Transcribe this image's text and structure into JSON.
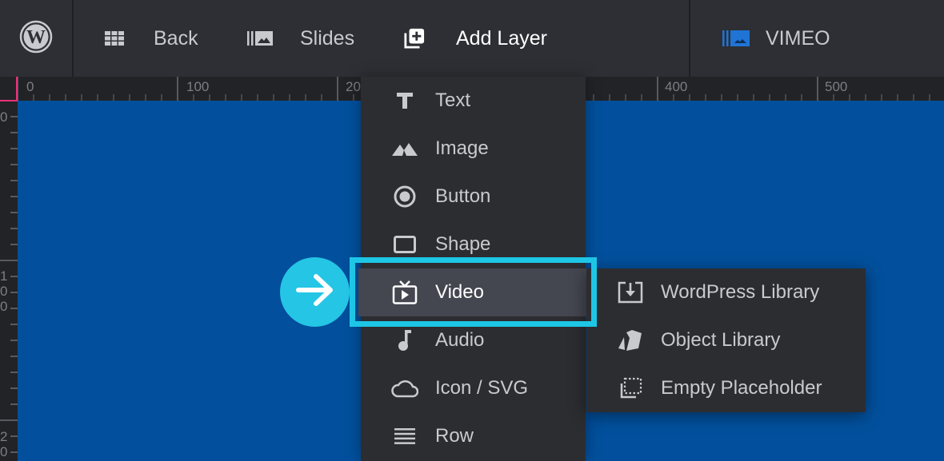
{
  "topbar": {
    "logo": "wordpress-icon",
    "items": [
      {
        "label": "Back",
        "icon": "grid-icon"
      },
      {
        "label": "Slides",
        "icon": "slides-icon"
      },
      {
        "label": "Add Layer",
        "icon": "add-layer-icon"
      },
      {
        "label": "VIMEO",
        "icon": "slider-icon"
      }
    ],
    "accent_color": "#1f74d6"
  },
  "ruler": {
    "top_labels": [
      "0",
      "100",
      "20",
      "400",
      "500"
    ],
    "left_labels": [
      "0",
      "1\n0\n0",
      "2\n0"
    ],
    "origin_marker_color": "#e6337a"
  },
  "canvas": {
    "background_color": "#02509d"
  },
  "add_layer_menu": {
    "items": [
      {
        "label": "Text",
        "icon": "text-icon"
      },
      {
        "label": "Image",
        "icon": "image-icon"
      },
      {
        "label": "Button",
        "icon": "button-icon"
      },
      {
        "label": "Shape",
        "icon": "shape-icon"
      },
      {
        "label": "Video",
        "icon": "video-icon",
        "selected": true
      },
      {
        "label": "Audio",
        "icon": "audio-icon"
      },
      {
        "label": "Icon / SVG",
        "icon": "cloud-icon"
      },
      {
        "label": "Row",
        "icon": "row-icon"
      }
    ]
  },
  "video_submenu": {
    "items": [
      {
        "label": "WordPress Library",
        "icon": "download-icon"
      },
      {
        "label": "Object Library",
        "icon": "object-library-icon"
      },
      {
        "label": "Empty Placeholder",
        "icon": "placeholder-icon"
      }
    ]
  },
  "annotation": {
    "highlight_color": "#1ec6e6",
    "pointer": "arrow-right-icon"
  }
}
